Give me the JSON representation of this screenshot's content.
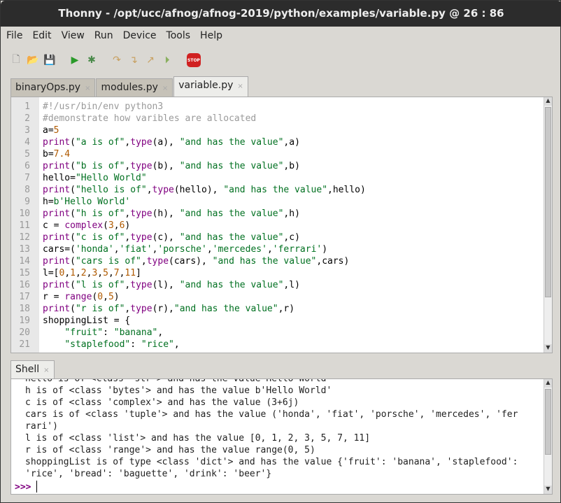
{
  "window": {
    "title": "Thonny  -  /opt/ucc/afnog/afnog-2019/python/examples/variable.py  @  26 : 86"
  },
  "menu": [
    "File",
    "Edit",
    "View",
    "Run",
    "Device",
    "Tools",
    "Help"
  ],
  "toolbar": [
    {
      "name": "new-file-icon",
      "glyph": "🗋",
      "color": "#888"
    },
    {
      "name": "open-file-icon",
      "glyph": "📂",
      "color": "#3a6ea5"
    },
    {
      "name": "save-file-icon",
      "glyph": "💾",
      "color": "#666"
    },
    {
      "name": "run-icon",
      "glyph": "▶",
      "color": "#2a9a2a"
    },
    {
      "name": "debug-icon",
      "glyph": "✱",
      "color": "#4a8a4a"
    },
    {
      "name": "step-over-icon",
      "glyph": "↷",
      "color": "#c8a060"
    },
    {
      "name": "step-into-icon",
      "glyph": "↴",
      "color": "#c8a060"
    },
    {
      "name": "step-out-icon",
      "glyph": "↗",
      "color": "#c8a060"
    },
    {
      "name": "resume-icon",
      "glyph": "⏵",
      "color": "#8ab060"
    },
    {
      "name": "stop-icon",
      "glyph": "STOP",
      "color": "#d02020"
    }
  ],
  "tabs": [
    {
      "label": "binaryOps.py"
    },
    {
      "label": "modules.py"
    },
    {
      "label": "variable.py",
      "active": true
    }
  ],
  "tab_close": "×",
  "editor": {
    "lines": [
      [
        [
          "c",
          "#!/usr/bin/env python3"
        ]
      ],
      [
        [
          "c",
          "#demonstrate how varibles are allocated"
        ]
      ],
      [
        [
          "p",
          "a="
        ],
        [
          "n",
          "5"
        ]
      ],
      [
        [
          "b",
          "print"
        ],
        [
          "p",
          "("
        ],
        [
          "s",
          "\"a is of\""
        ],
        [
          "p",
          ","
        ],
        [
          "b",
          "type"
        ],
        [
          "p",
          "(a), "
        ],
        [
          "s",
          "\"and has the value\""
        ],
        [
          "p",
          ",a)"
        ]
      ],
      [
        [
          "p",
          "b="
        ],
        [
          "n",
          "7.4"
        ]
      ],
      [
        [
          "b",
          "print"
        ],
        [
          "p",
          "("
        ],
        [
          "s",
          "\"b is of\""
        ],
        [
          "p",
          ","
        ],
        [
          "b",
          "type"
        ],
        [
          "p",
          "(b), "
        ],
        [
          "s",
          "\"and has the value\""
        ],
        [
          "p",
          ",b)"
        ]
      ],
      [
        [
          "p",
          "hello="
        ],
        [
          "s",
          "\"Hello World\""
        ]
      ],
      [
        [
          "b",
          "print"
        ],
        [
          "p",
          "("
        ],
        [
          "s",
          "\"hello is of\""
        ],
        [
          "p",
          ","
        ],
        [
          "b",
          "type"
        ],
        [
          "p",
          "(hello), "
        ],
        [
          "s",
          "\"and has the value\""
        ],
        [
          "p",
          ",hello)"
        ]
      ],
      [
        [
          "p",
          "h="
        ],
        [
          "s",
          "b'Hello World'"
        ]
      ],
      [
        [
          "b",
          "print"
        ],
        [
          "p",
          "("
        ],
        [
          "s",
          "\"h is of\""
        ],
        [
          "p",
          ","
        ],
        [
          "b",
          "type"
        ],
        [
          "p",
          "(h), "
        ],
        [
          "s",
          "\"and has the value\""
        ],
        [
          "p",
          ",h)"
        ]
      ],
      [
        [
          "p",
          "c = "
        ],
        [
          "b",
          "complex"
        ],
        [
          "p",
          "("
        ],
        [
          "n",
          "3"
        ],
        [
          "p",
          ","
        ],
        [
          "n",
          "6"
        ],
        [
          "p",
          ")"
        ]
      ],
      [
        [
          "b",
          "print"
        ],
        [
          "p",
          "("
        ],
        [
          "s",
          "\"c is of\""
        ],
        [
          "p",
          ","
        ],
        [
          "b",
          "type"
        ],
        [
          "p",
          "(c), "
        ],
        [
          "s",
          "\"and has the value\""
        ],
        [
          "p",
          ",c)"
        ]
      ],
      [
        [
          "p",
          "cars=("
        ],
        [
          "s",
          "'honda'"
        ],
        [
          "p",
          ","
        ],
        [
          "s",
          "'fiat'"
        ],
        [
          "p",
          ","
        ],
        [
          "s",
          "'porsche'"
        ],
        [
          "p",
          ","
        ],
        [
          "s",
          "'mercedes'"
        ],
        [
          "p",
          ","
        ],
        [
          "s",
          "'ferrari'"
        ],
        [
          "p",
          ")"
        ]
      ],
      [
        [
          "b",
          "print"
        ],
        [
          "p",
          "("
        ],
        [
          "s",
          "\"cars is of\""
        ],
        [
          "p",
          ","
        ],
        [
          "b",
          "type"
        ],
        [
          "p",
          "(cars), "
        ],
        [
          "s",
          "\"and has the value\""
        ],
        [
          "p",
          ",cars)"
        ]
      ],
      [
        [
          "p",
          "l=["
        ],
        [
          "n",
          "0"
        ],
        [
          "p",
          ","
        ],
        [
          "n",
          "1"
        ],
        [
          "p",
          ","
        ],
        [
          "n",
          "2"
        ],
        [
          "p",
          ","
        ],
        [
          "n",
          "3"
        ],
        [
          "p",
          ","
        ],
        [
          "n",
          "5"
        ],
        [
          "p",
          ","
        ],
        [
          "n",
          "7"
        ],
        [
          "p",
          ","
        ],
        [
          "n",
          "11"
        ],
        [
          "p",
          "]"
        ]
      ],
      [
        [
          "b",
          "print"
        ],
        [
          "p",
          "("
        ],
        [
          "s",
          "\"l is of\""
        ],
        [
          "p",
          ","
        ],
        [
          "b",
          "type"
        ],
        [
          "p",
          "(l), "
        ],
        [
          "s",
          "\"and has the value\""
        ],
        [
          "p",
          ",l)"
        ]
      ],
      [
        [
          "p",
          "r = "
        ],
        [
          "b",
          "range"
        ],
        [
          "p",
          "("
        ],
        [
          "n",
          "0"
        ],
        [
          "p",
          ","
        ],
        [
          "n",
          "5"
        ],
        [
          "p",
          ")"
        ]
      ],
      [
        [
          "b",
          "print"
        ],
        [
          "p",
          "("
        ],
        [
          "s",
          "\"r is of\""
        ],
        [
          "p",
          ","
        ],
        [
          "b",
          "type"
        ],
        [
          "p",
          "(r),"
        ],
        [
          "s",
          "\"and has the value\""
        ],
        [
          "p",
          ",r)"
        ]
      ],
      [
        [
          "p",
          "shoppingList = {"
        ]
      ],
      [
        [
          "p",
          "    "
        ],
        [
          "s",
          "\"fruit\""
        ],
        [
          "p",
          ": "
        ],
        [
          "s",
          "\"banana\""
        ],
        [
          "p",
          ","
        ]
      ],
      [
        [
          "p",
          "    "
        ],
        [
          "s",
          "\"staplefood\""
        ],
        [
          "p",
          ": "
        ],
        [
          "s",
          "\"rice\""
        ],
        [
          "p",
          ","
        ]
      ]
    ]
  },
  "shell": {
    "tab_label": "Shell",
    "output": [
      "hello is of <class 'str'> and has the value Hello World",
      "h is of <class 'bytes'> and has the value b'Hello World'",
      "c is of <class 'complex'> and has the value (3+6j)",
      "cars is of <class 'tuple'> and has the value ('honda', 'fiat', 'porsche', 'mercedes', 'fer",
      "rari')",
      "l is of <class 'list'> and has the value [0, 1, 2, 3, 5, 7, 11]",
      "r is of <class 'range'> and has the value range(0, 5)",
      "shoppingList is of type <class 'dict'> and has the value {'fruit': 'banana', 'staplefood':",
      "'rice', 'bread': 'baguette', 'drink': 'beer'}"
    ],
    "prompt": ">>>"
  }
}
